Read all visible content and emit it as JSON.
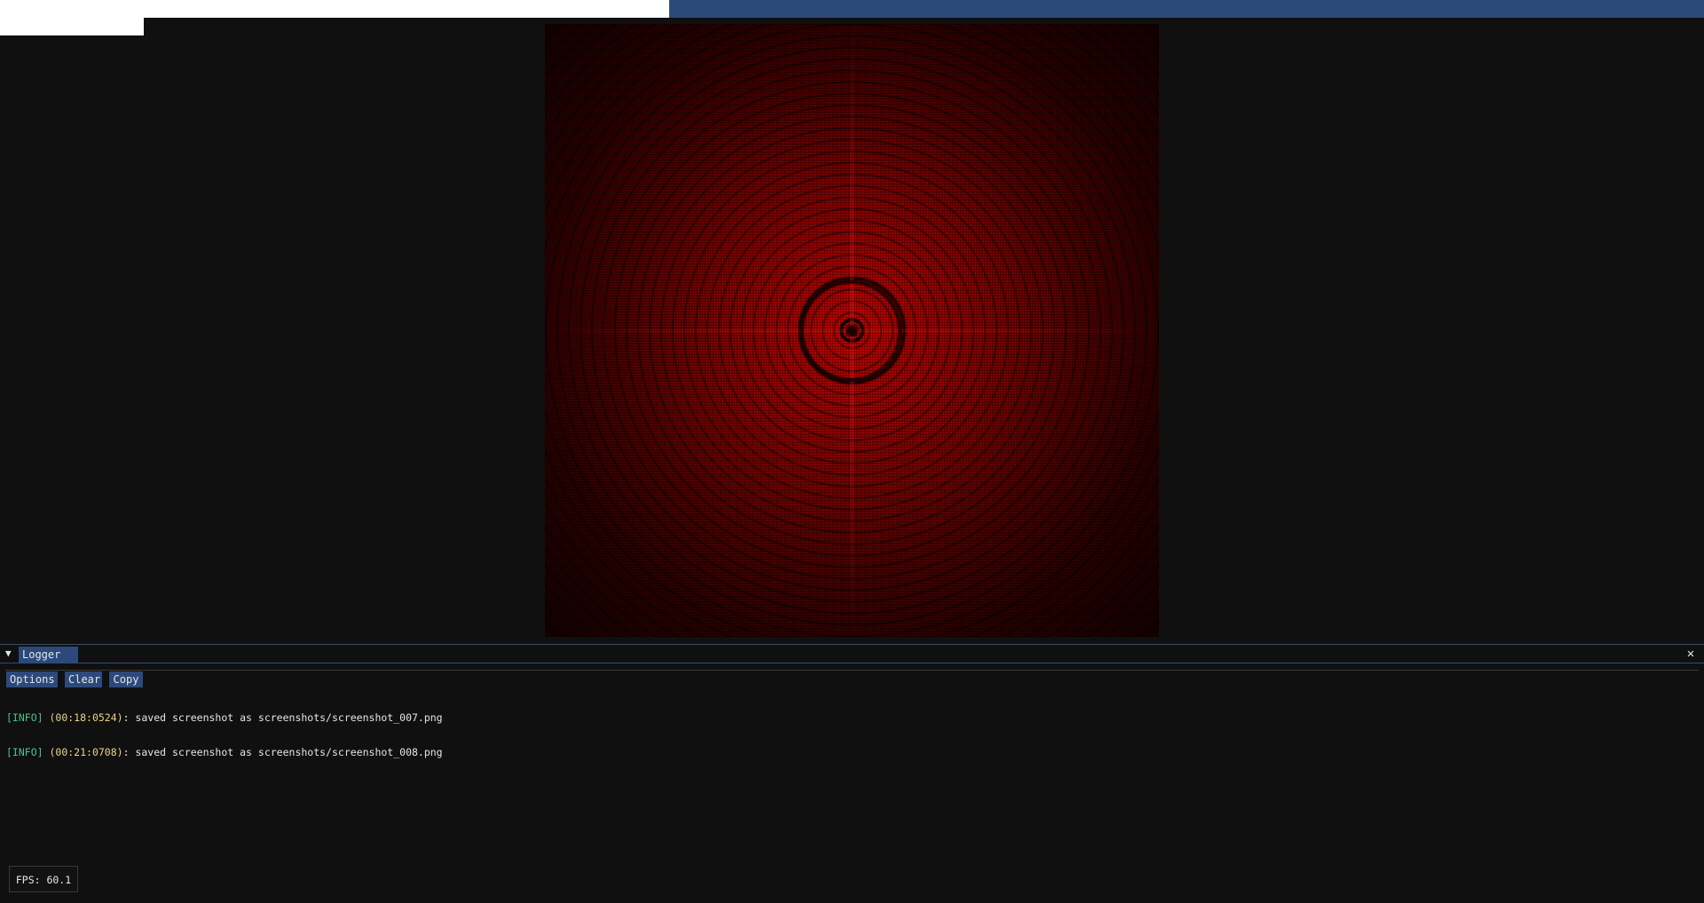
{
  "logger": {
    "tab_label": "Logger",
    "buttons": {
      "options": "Options",
      "clear": "Clear",
      "copy": "Copy"
    },
    "entries": [
      {
        "level": "[INFO]",
        "time": "(00:18:0524)",
        "message": ": saved screenshot as screenshots/screenshot_007.png"
      },
      {
        "level": "[INFO]",
        "time": "(00:21:0708)",
        "message": ": saved screenshot as screenshots/screenshot_008.png"
      }
    ]
  },
  "status": {
    "fps": "FPS: 60.1"
  },
  "icons": {
    "collapse": "triangle-down-icon",
    "close": "close-icon"
  },
  "colors": {
    "accent": "#2b4a7b",
    "background": "#101010",
    "log_level": "#4fc08d",
    "log_time": "#e8d48a",
    "render": "#c00000"
  }
}
